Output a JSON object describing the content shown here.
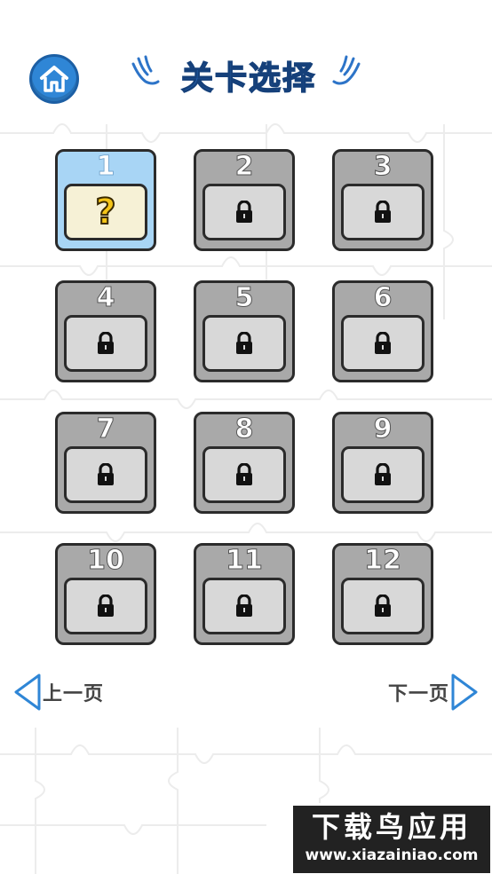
{
  "header": {
    "home_icon": "home-icon",
    "title": "关卡选择"
  },
  "levels": [
    {
      "number": "1",
      "state": "unlocked",
      "icon": "question-mark",
      "icon_text": "?"
    },
    {
      "number": "2",
      "state": "locked",
      "icon": "lock-icon"
    },
    {
      "number": "3",
      "state": "locked",
      "icon": "lock-icon"
    },
    {
      "number": "4",
      "state": "locked",
      "icon": "lock-icon"
    },
    {
      "number": "5",
      "state": "locked",
      "icon": "lock-icon"
    },
    {
      "number": "6",
      "state": "locked",
      "icon": "lock-icon"
    },
    {
      "number": "7",
      "state": "locked",
      "icon": "lock-icon"
    },
    {
      "number": "8",
      "state": "locked",
      "icon": "lock-icon"
    },
    {
      "number": "9",
      "state": "locked",
      "icon": "lock-icon"
    },
    {
      "number": "10",
      "state": "locked",
      "icon": "lock-icon"
    },
    {
      "number": "11",
      "state": "locked",
      "icon": "lock-icon"
    },
    {
      "number": "12",
      "state": "locked",
      "icon": "lock-icon"
    }
  ],
  "pagination": {
    "prev_label": "上一页",
    "next_label": "下一页"
  },
  "watermark": {
    "line1": "下载鸟应用",
    "line2": "www.xiazainiao.com"
  },
  "colors": {
    "accent_blue": "#2f86d6",
    "unlocked_tile": "#a8d5f5",
    "locked_tile": "#a9a9a9",
    "question_mark": "#f5c518"
  }
}
